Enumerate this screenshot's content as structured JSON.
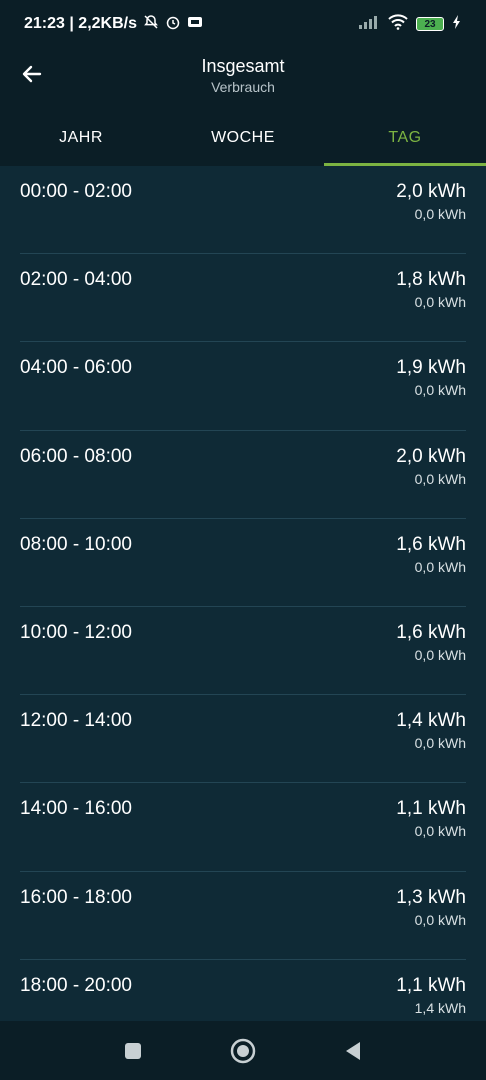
{
  "status": {
    "time_speed": "21:23 | 2,2KB/s",
    "battery": "23"
  },
  "header": {
    "title": "Insgesamt",
    "subtitle": "Verbrauch"
  },
  "tabs": [
    "JAHR",
    "WOCHE",
    "TAG"
  ],
  "rows": [
    {
      "time": "00:00 - 02:00",
      "main": "2,0 kWh",
      "sub": "0,0 kWh"
    },
    {
      "time": "02:00 - 04:00",
      "main": "1,8 kWh",
      "sub": "0,0 kWh"
    },
    {
      "time": "04:00 - 06:00",
      "main": "1,9 kWh",
      "sub": "0,0 kWh"
    },
    {
      "time": "06:00 - 08:00",
      "main": "2,0 kWh",
      "sub": "0,0 kWh"
    },
    {
      "time": "08:00 - 10:00",
      "main": "1,6 kWh",
      "sub": "0,0 kWh"
    },
    {
      "time": "10:00 - 12:00",
      "main": "1,6 kWh",
      "sub": "0,0 kWh"
    },
    {
      "time": "12:00 - 14:00",
      "main": "1,4 kWh",
      "sub": "0,0 kWh"
    },
    {
      "time": "14:00 - 16:00",
      "main": "1,1 kWh",
      "sub": "0,0 kWh"
    },
    {
      "time": "16:00 - 18:00",
      "main": "1,3 kWh",
      "sub": "0,0 kWh"
    },
    {
      "time": "18:00 - 20:00",
      "main": "1,1 kWh",
      "sub": "1,4 kWh"
    }
  ],
  "colors": {
    "accent": "#7cb342",
    "background": "#0f2a36",
    "bar": "#0b1e26"
  }
}
